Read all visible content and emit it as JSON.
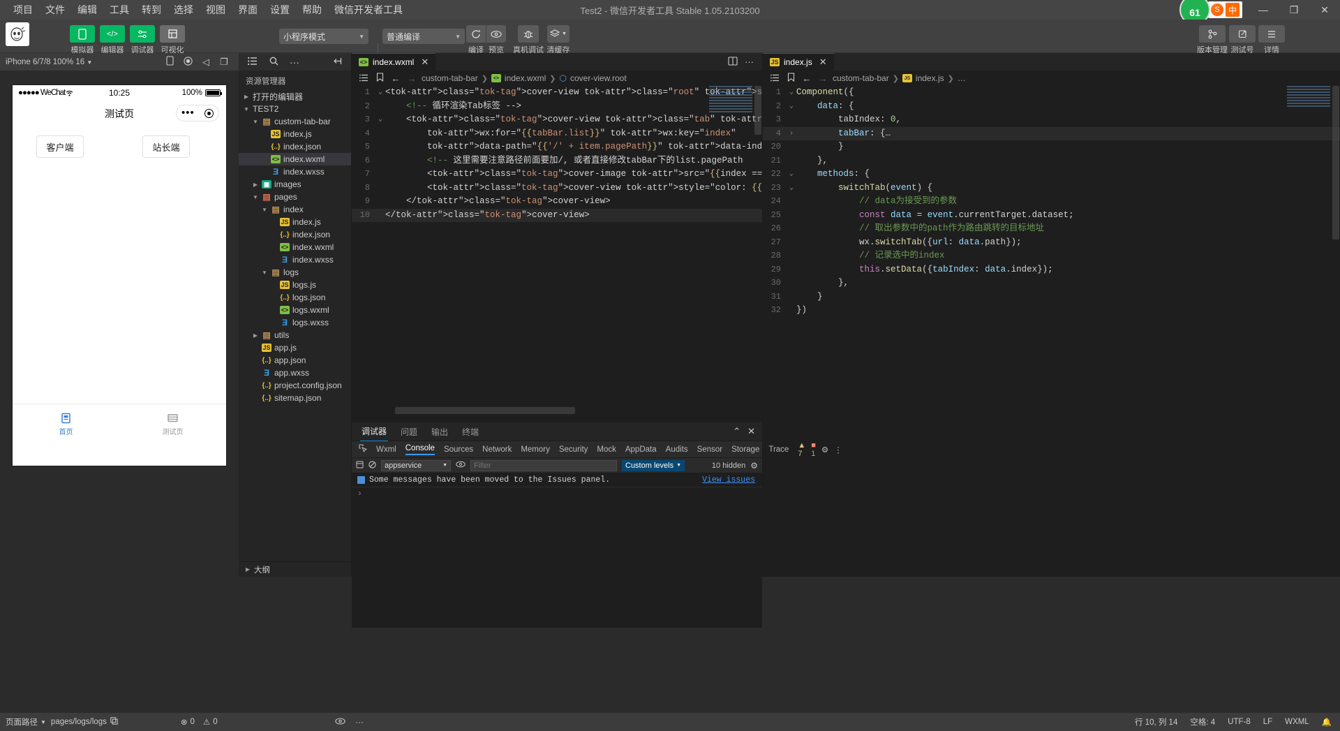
{
  "titlebar": {
    "menus": [
      "项目",
      "文件",
      "编辑",
      "工具",
      "转到",
      "选择",
      "视图",
      "界面",
      "设置",
      "帮助",
      "微信开发者工具"
    ],
    "title": "Test2 - 微信开发者工具 Stable 1.05.2103200",
    "ime_badge": "中",
    "avatar_count": "61",
    "minimize": "—",
    "maximize": "❐",
    "close": "✕"
  },
  "toolbar": {
    "left_buttons": [
      {
        "label": "模拟器",
        "icon": "phone-icon",
        "style": "green"
      },
      {
        "label": "编辑器",
        "icon": "code-icon",
        "style": "green"
      },
      {
        "label": "调试器",
        "icon": "sliders-icon",
        "style": "green"
      },
      {
        "label": "可视化",
        "icon": "layout-icon",
        "style": "gray"
      }
    ],
    "mode_select": "小程序模式",
    "compile_select": "普通编译",
    "action_buttons": [
      {
        "label": "编译",
        "icon": "refresh-icon"
      },
      {
        "label": "预览",
        "icon": "eye-icon"
      },
      {
        "label": "真机调试",
        "icon": "bug-icon"
      },
      {
        "label": "清缓存",
        "icon": "layers-icon"
      }
    ],
    "right_buttons": [
      {
        "label": "版本管理",
        "icon": "branch-icon"
      },
      {
        "label": "测试号",
        "icon": "external-link-icon"
      },
      {
        "label": "详情",
        "icon": "menu-icon"
      }
    ]
  },
  "simulator": {
    "device": "iPhone 6/7/8 100% 16",
    "icons": [
      "rotate-icon",
      "record-icon",
      "mute-icon",
      "window-icon"
    ],
    "status": {
      "carrier": "●●●●● WeChat",
      "time": "10:25",
      "battery": "100%"
    },
    "nav_title": "测试页",
    "buttons": [
      {
        "label": "客户端"
      },
      {
        "label": "站长端"
      }
    ],
    "tabbar": [
      {
        "label": "首页",
        "icon": "home-icon",
        "active": true
      },
      {
        "label": "测试页",
        "icon": "list-icon",
        "active": false
      }
    ],
    "active_color": "#3b7fd4",
    "inactive_color": "#999999"
  },
  "explorer": {
    "header_icons": [
      "files-icon",
      "search-icon",
      "more-icon",
      "collapse-icon"
    ],
    "title": "资源管理器",
    "open_editors": "打开的编辑器",
    "project_name": "TEST2",
    "outline": "大纲",
    "tree": [
      {
        "label": "custom-tab-bar",
        "type": "folder",
        "indent": 1,
        "open": true
      },
      {
        "label": "index.js",
        "type": "js",
        "indent": 2
      },
      {
        "label": "index.json",
        "type": "json",
        "indent": 2
      },
      {
        "label": "index.wxml",
        "type": "wxml",
        "indent": 2,
        "selected": true
      },
      {
        "label": "index.wxss",
        "type": "wxss",
        "indent": 2
      },
      {
        "label": "images",
        "type": "imagefolder",
        "indent": 1,
        "open": false
      },
      {
        "label": "pages",
        "type": "pagefolder",
        "indent": 1,
        "open": true
      },
      {
        "label": "index",
        "type": "folder",
        "indent": 2,
        "open": true
      },
      {
        "label": "index.js",
        "type": "js",
        "indent": 3
      },
      {
        "label": "index.json",
        "type": "json",
        "indent": 3
      },
      {
        "label": "index.wxml",
        "type": "wxml",
        "indent": 3
      },
      {
        "label": "index.wxss",
        "type": "wxss",
        "indent": 3
      },
      {
        "label": "logs",
        "type": "folder",
        "indent": 2,
        "open": true
      },
      {
        "label": "logs.js",
        "type": "js",
        "indent": 3
      },
      {
        "label": "logs.json",
        "type": "json",
        "indent": 3
      },
      {
        "label": "logs.wxml",
        "type": "wxml",
        "indent": 3
      },
      {
        "label": "logs.wxss",
        "type": "wxss",
        "indent": 3
      },
      {
        "label": "utils",
        "type": "folder",
        "indent": 1,
        "open": false
      },
      {
        "label": "app.js",
        "type": "js",
        "indent": 1
      },
      {
        "label": "app.json",
        "type": "json",
        "indent": 1
      },
      {
        "label": "app.wxss",
        "type": "wxss",
        "indent": 1
      },
      {
        "label": "project.config.json",
        "type": "json",
        "indent": 1
      },
      {
        "label": "sitemap.json",
        "type": "json",
        "indent": 1
      }
    ]
  },
  "editor_wxml": {
    "tab_label": "index.wxml",
    "tab_close": "✕",
    "breadcrumb": [
      "custom-tab-bar",
      "index.wxml",
      "cover-view.root"
    ],
    "lines": [
      {
        "n": "1",
        "fold": "⌄",
        "text": "<cover-view class=\"root\" style=\"background-color: {{tabBar.backgroundCo"
      },
      {
        "n": "2",
        "fold": "",
        "text": "    <!-- 循环渲染Tab标签 -->"
      },
      {
        "n": "3",
        "fold": "⌄",
        "text": "    <cover-view class=\"tab\" bindtap=\"switchTab\""
      },
      {
        "n": "4",
        "fold": "",
        "text": "        wx:for=\"{{tabBar.list}}\" wx:key=\"index\""
      },
      {
        "n": "5",
        "fold": "",
        "text": "        data-path=\"{{'/' + item.pagePath}}\" data-index=\"{{index}}\">"
      },
      {
        "n": "6",
        "fold": "",
        "text": "        <!-- 这里需要注意路径前面要加/, 或者直接修改tabBar下的list.pagePath"
      },
      {
        "n": "7",
        "fold": "",
        "text": "        <cover-image src=\"{{index == tabIndex ? item.selectedIconPath :"
      },
      {
        "n": "8",
        "fold": "",
        "text": "        <cover-view style=\"color: {{index == tabIndex ? tabBar.selectedC"
      },
      {
        "n": "9",
        "fold": "",
        "text": "    </cover-view>"
      },
      {
        "n": "10",
        "fold": "",
        "text": "</cover-view>",
        "highlight": true
      }
    ]
  },
  "editor_js": {
    "tab_label": "index.js",
    "tab_close": "✕",
    "breadcrumb": [
      "custom-tab-bar",
      "index.js",
      "…"
    ],
    "lines": [
      {
        "n": "1",
        "fold": "⌄",
        "text": "Component({"
      },
      {
        "n": "2",
        "fold": "⌄",
        "text": "    data: {"
      },
      {
        "n": "3",
        "fold": "",
        "text": "        tabIndex: 0,"
      },
      {
        "n": "4",
        "fold": "›",
        "text": "        tabBar: {…",
        "highlight": true
      },
      {
        "n": "20",
        "fold": "",
        "text": "        }"
      },
      {
        "n": "21",
        "fold": "",
        "text": "    },"
      },
      {
        "n": "22",
        "fold": "⌄",
        "text": "    methods: {"
      },
      {
        "n": "23",
        "fold": "⌄",
        "text": "        switchTab(event) {"
      },
      {
        "n": "24",
        "fold": "",
        "text": "            // data为接受到的参数"
      },
      {
        "n": "25",
        "fold": "",
        "text": "            const data = event.currentTarget.dataset;"
      },
      {
        "n": "26",
        "fold": "",
        "text": "            // 取出参数中的path作为路由跳转的目标地址"
      },
      {
        "n": "27",
        "fold": "",
        "text": "            wx.switchTab({url: data.path});"
      },
      {
        "n": "28",
        "fold": "",
        "text": "            // 记录选中的index"
      },
      {
        "n": "29",
        "fold": "",
        "text": "            this.setData({tabIndex: data.index});"
      },
      {
        "n": "30",
        "fold": "",
        "text": "        },"
      },
      {
        "n": "31",
        "fold": "",
        "text": "    }"
      },
      {
        "n": "32",
        "fold": "",
        "text": "})"
      }
    ]
  },
  "debugger": {
    "panel_tabs": [
      {
        "label": "调试器",
        "active": true
      },
      {
        "label": "问题",
        "active": false
      },
      {
        "label": "输出",
        "active": false
      },
      {
        "label": "终端",
        "active": false
      }
    ],
    "collapse_icon": "⌃",
    "close_icon": "✕",
    "devtools_tabs": [
      {
        "label": "Wxml",
        "active": false
      },
      {
        "label": "Console",
        "active": true
      },
      {
        "label": "Sources",
        "active": false
      },
      {
        "label": "Network",
        "active": false
      },
      {
        "label": "Memory",
        "active": false
      },
      {
        "label": "Security",
        "active": false
      },
      {
        "label": "Mock",
        "active": false
      },
      {
        "label": "AppData",
        "active": false
      },
      {
        "label": "Audits",
        "active": false
      },
      {
        "label": "Sensor",
        "active": false
      },
      {
        "label": "Storage",
        "active": false
      },
      {
        "label": "Trace",
        "active": false
      }
    ],
    "warning_count": "7",
    "error_count": "1",
    "settings_icon": "gear-icon",
    "more_icon": "more-icon",
    "console": {
      "context": "appservice",
      "filter_placeholder": "Filter",
      "levels_label": "Custom levels",
      "hidden_label": "10 hidden",
      "message": "Some messages have been moved to the Issues panel.",
      "view_issues": "View issues",
      "prompt": "›"
    }
  },
  "statusbar": {
    "page_path_label": "页面路径",
    "page_path_value": "pages/logs/logs",
    "problems": {
      "errors": "0",
      "warnings": "0"
    },
    "cursor": "行 10, 列 14",
    "spaces": "空格: 4",
    "encoding": "UTF-8",
    "eol": "LF",
    "language": "WXML",
    "bell_icon": "bell-icon",
    "eye_icon": "eye-icon",
    "more_icon": "more-icon",
    "copy_icon": "copy-icon"
  }
}
